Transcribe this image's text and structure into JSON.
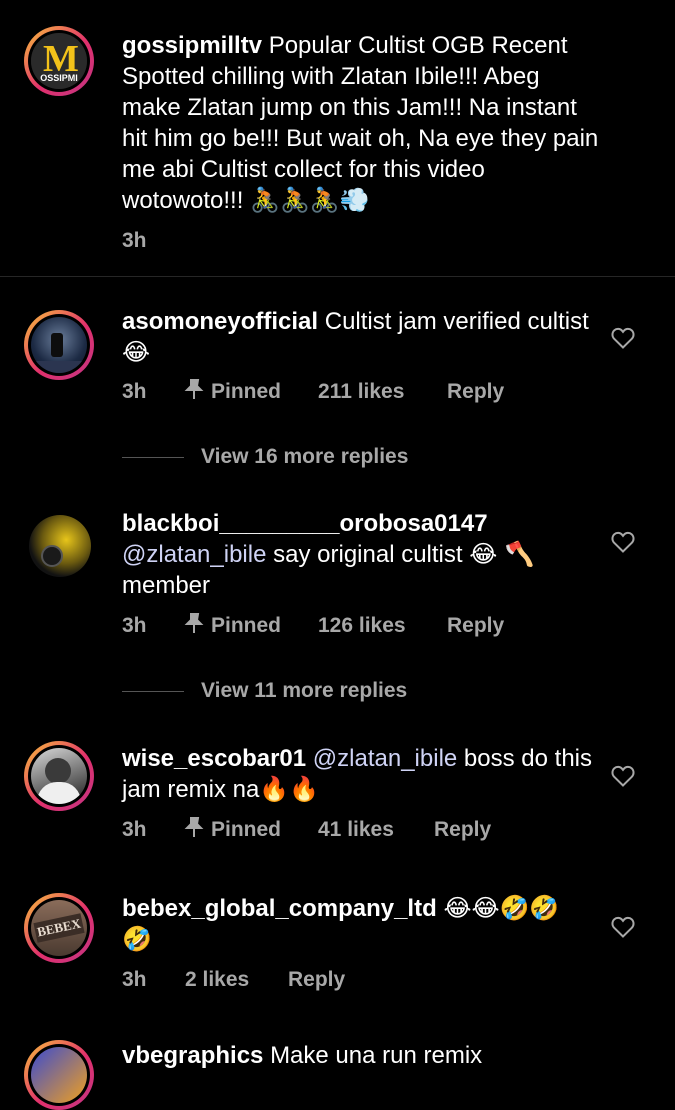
{
  "caption": {
    "username": "gossipmilltv",
    "text": "Popular Cultist OGB Recent Spotted chilling with Zlatan Ibile!!! Abeg make Zlatan jump on this Jam!!! Na instant hit him go be!!! But wait oh, Na eye they pain me abi Cultist collect for this video wotowoto!!!",
    "emojis": "🚴🚴🚴💨",
    "time": "3h",
    "avatar_letter": "M",
    "avatar_text": "OSSIPMI"
  },
  "comments": [
    {
      "username": "asomoneyofficial",
      "text": "Cultist jam verified cultist",
      "emoji": "😂",
      "time": "3h",
      "pinned": "Pinned",
      "likes": "211 likes",
      "reply": "Reply",
      "view_more": "View 16 more replies"
    },
    {
      "username": "blackboi_________orobosa0147",
      "mention": "@zlatan_ibile",
      "text": "say original cultist",
      "emoji": "😂 🪓",
      "text2": "member",
      "time": "3h",
      "pinned": "Pinned",
      "likes": "126 likes",
      "reply": "Reply",
      "view_more": "View 11 more replies"
    },
    {
      "username": "wise_escobar01",
      "mention": "@zlatan_ibile",
      "text": "boss do this jam remix na",
      "emoji": "🔥🔥",
      "time": "3h",
      "pinned": "Pinned",
      "likes": "41 likes",
      "reply": "Reply"
    },
    {
      "username": "bebex_global_company_ltd",
      "emoji": "😂😂🤣🤣",
      "emoji2": "🤣",
      "time": "3h",
      "likes": "2 likes",
      "reply": "Reply",
      "avatar_text": "BEBEX"
    },
    {
      "username": "vbegraphics",
      "text": "Make una run remix"
    }
  ],
  "colors": {
    "background": "#000000",
    "text": "#ffffff",
    "meta": "#a8a8a8",
    "mention": "#cfd3f5",
    "ring_start": "#f9c33a",
    "ring_end": "#c13584"
  }
}
